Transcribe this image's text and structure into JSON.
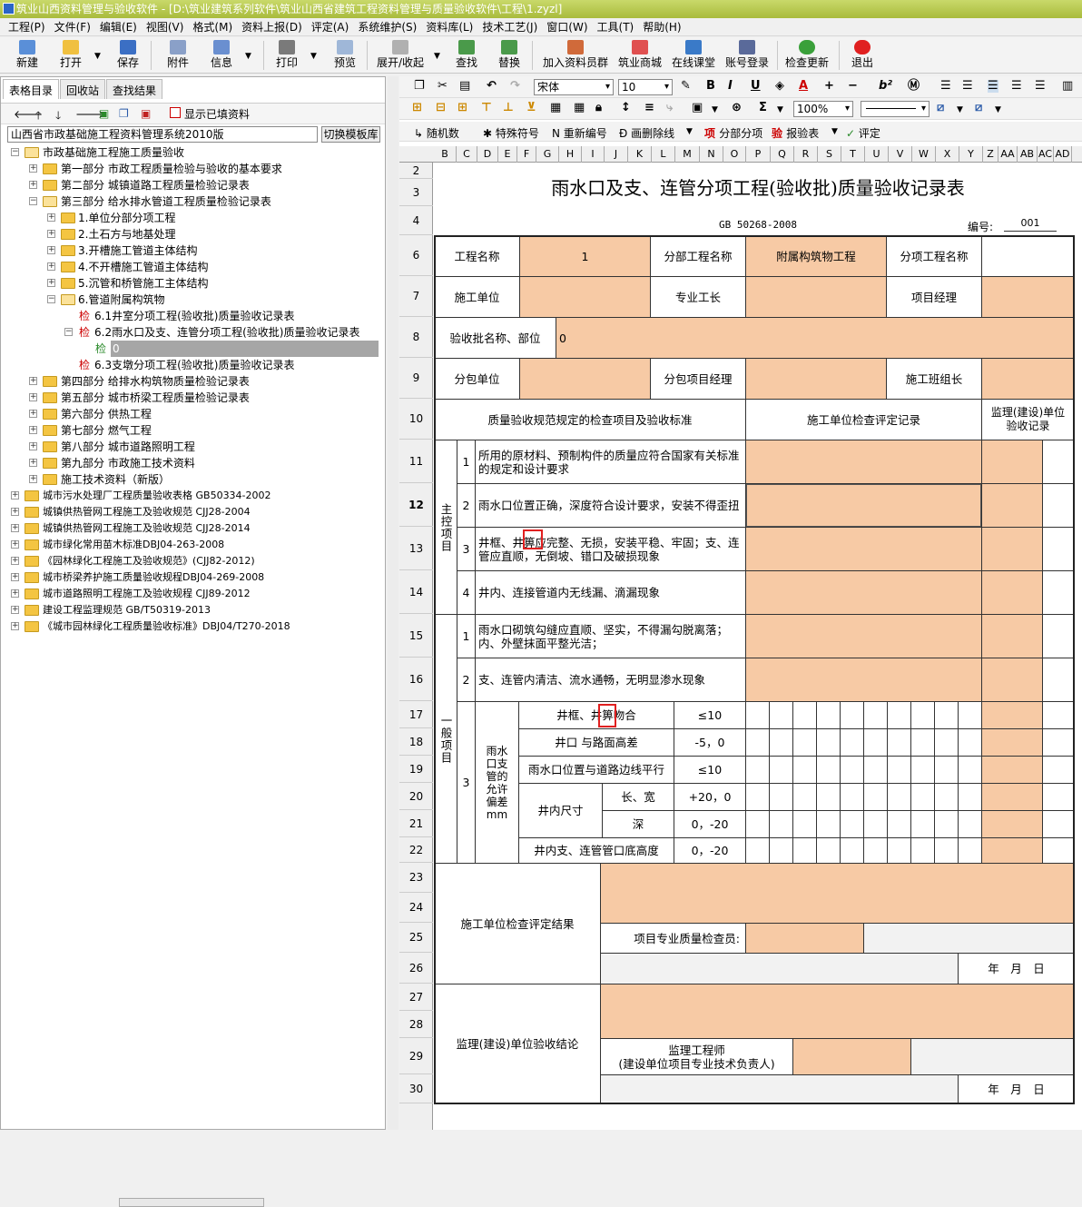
{
  "window": {
    "title": "筑业山西资料管理与验收软件 - [D:\\筑业建筑系列软件\\筑业山西省建筑工程资料管理与质量验收软件\\工程\\1.zyzl]"
  },
  "menu": [
    "工程(P)",
    "文件(F)",
    "编辑(E)",
    "视图(V)",
    "格式(M)",
    "资料上报(D)",
    "评定(A)",
    "系统维护(S)",
    "资料库(L)",
    "技术工艺(J)",
    "窗口(W)",
    "工具(T)",
    "帮助(H)"
  ],
  "toolbar": {
    "new": "新建",
    "open": "打开",
    "save": "保存",
    "attach": "附件",
    "info": "信息",
    "print": "打印",
    "preview": "预览",
    "expand": "展开/收起",
    "find": "查找",
    "replace": "替换",
    "join": "加入资料员群",
    "shop": "筑业商城",
    "class": "在线课堂",
    "login": "账号登录",
    "update": "检查更新",
    "exit": "退出"
  },
  "left": {
    "tabs": [
      "表格目录",
      "回收站",
      "查找结果"
    ],
    "show_filled": "显示已填资料",
    "system_name": "山西省市政基础施工程资料管理系统2010版",
    "switch_template": "切换模板库",
    "jian": "检",
    "tree": [
      "市政基础施工程施工质量验收",
      "第一部分 市政工程质量检验与验收的基本要求",
      "第二部分 城镇道路工程质量检验记录表",
      "第三部分 给水排水管道工程质量检验记录表",
      "1.单位分部分项工程",
      "2.土石方与地基处理",
      "3.开槽施工管道主体结构",
      "4.不开槽施工管道主体结构",
      "5.沉管和桥管施工主体结构",
      "6.管道附属构筑物",
      "6.1井室分项工程(验收批)质量验收记录表",
      "6.2雨水口及支、连管分项工程(验收批)质量验收记录表",
      "0",
      "6.3支墩分项工程(验收批)质量验收记录表",
      "第四部分 给排水构筑物质量检验记录表",
      "第五部分 城市桥梁工程质量检验记录表",
      "第六部分 供热工程",
      "第七部分 燃气工程",
      "第八部分 城市道路照明工程",
      "第九部分 市政施工技术资料",
      "施工技术资料（新版）",
      "城市污水处理厂工程质量验收表格 GB50334-2002",
      "城镇供热管网工程施工及验收规范 CJJ28-2004",
      "城镇供热管网工程施工及验收规范 CJJ28-2014",
      "城市绿化常用苗木标准DBJ04-263-2008",
      "《园林绿化工程施工及验收规范》(CJJ82-2012)",
      "城市桥梁养护施工质量验收规程DBJ04-269-2008",
      "城市道路照明工程施工及验收规程 CJJ89-2012",
      "建设工程监理规范 GB/T50319-2013",
      "《城市园林绿化工程质量验收标准》DBJ04/T270-2018"
    ]
  },
  "editor": {
    "font": "宋体",
    "size": "10",
    "zoom": "100%",
    "tb3": [
      "随机数",
      "特殊符号",
      "重新编号",
      "画删除线",
      "分部分项",
      "报验表",
      "评定"
    ],
    "cols": [
      "B",
      "C",
      "D",
      "E",
      "F",
      "G",
      "H",
      "I",
      "J",
      "K",
      "L",
      "M",
      "N",
      "O",
      "P",
      "Q",
      "R",
      "S",
      "T",
      "U",
      "V",
      "W",
      "X",
      "Y",
      "Z",
      "AA",
      "AB",
      "AC",
      "AD"
    ],
    "rows": [
      "2",
      "3",
      "4",
      "6",
      "7",
      "8",
      "9",
      "10",
      "11",
      "12",
      "13",
      "14",
      "15",
      "16",
      "17",
      "18",
      "19",
      "20",
      "21",
      "22",
      "23",
      "24",
      "25",
      "26",
      "27",
      "28",
      "29",
      "30"
    ]
  },
  "form": {
    "title": "雨水口及支、连管分项工程(验收批)质量验收记录表",
    "standard": "GB 50268-2008",
    "number_label": "编号:",
    "number": "001",
    "project_name_label": "工程名称",
    "project_name": "1",
    "sub_project_label": "分部工程名称",
    "sub_project": "附属构筑物工程",
    "item_project_label": "分项工程名称",
    "builder_label": "施工单位",
    "foreman_label": "专业工长",
    "manager_label": "项目经理",
    "batch_label": "验收批名称、部位",
    "batch": "0",
    "sub_unit_label": "分包单位",
    "sub_manager_label": "分包项目经理",
    "team_label": "施工班组长",
    "std_header": "质量验收规范规定的检查项目及验收标准",
    "check_header": "施工单位检查评定记录",
    "super_header": "监理(建设)单位验收记录",
    "main_label": "主控项目",
    "general_label": "一般项目",
    "main_items": [
      {
        "no": "1",
        "text": "所用的原材料、预制构件的质量应符合国家有关标准的规定和设计要求"
      },
      {
        "no": "2",
        "text": "雨水口位置正确，深度符合设计要求，安装不得歪扭"
      },
      {
        "no": "3",
        "text": "井框、井箅应完整、无损，安装平稳、牢固；支、连管应直顺，无倒坡、错口及破损现象"
      },
      {
        "no": "4",
        "text": "井内、连接管道内无线漏、滴漏现象"
      }
    ],
    "general_items": [
      {
        "no": "1",
        "text": "雨水口砌筑勾缝应直顺、坚实，不得漏勾脱离落；内、外壁抹面平整光洁；"
      },
      {
        "no": "2",
        "text": "支、连管内清洁、流水通畅，无明显渗水现象"
      }
    ],
    "dev_no": "3",
    "dev_label": "雨水口支管的允许偏差mm",
    "dev_rows": [
      {
        "item": "井框、井箅吻合",
        "val": "≤10"
      },
      {
        "item": "井口 与路面高差",
        "val": "-5，0"
      },
      {
        "item": "雨水口位置与道路边线平行",
        "val": "≤10"
      },
      {
        "item": "长、宽",
        "val": "+20，0"
      },
      {
        "item": "深",
        "val": "0，-20"
      },
      {
        "item": "井内支、连管管口底高度",
        "val": "0，-20"
      }
    ],
    "inner_size": "井内尺寸",
    "result_label": "施工单位检查评定结果",
    "inspector_label": "项目专业质量检查员:",
    "date": "年　月　日",
    "conclusion_label": "监理(建设)单位验收结论",
    "engineer_label": "监理工程师",
    "engineer_sub": "(建设单位项目专业技术负责人)"
  }
}
